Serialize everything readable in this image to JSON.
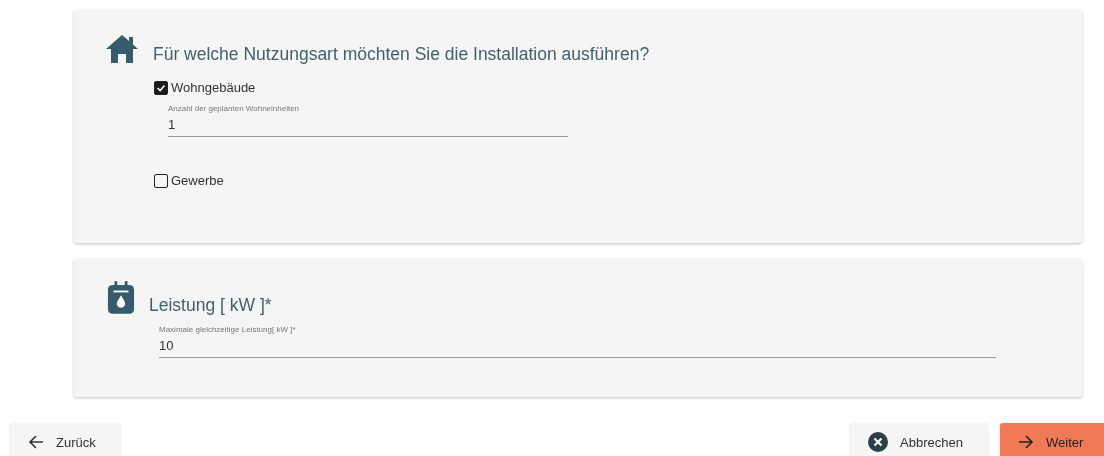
{
  "sections": [
    {
      "kind": "usage",
      "title": "Für welche Nutzungsart möchten Sie die Installation ausführen?",
      "options": [
        {
          "label": "Wohngebäude",
          "checked": true,
          "field": {
            "label": "Anzahl der geplanten Wohneinheiten",
            "value": "1"
          }
        },
        {
          "label": "Gewerbe",
          "checked": false
        }
      ]
    },
    {
      "kind": "power",
      "title": "Leistung [ kW ]*",
      "field": {
        "label": "Maximale gleichzeitige Leistung[ kW ]*",
        "value": "10"
      }
    }
  ],
  "buttons": [
    {
      "label": "Zurück",
      "kind": "back"
    },
    {
      "label": "Abbrechen",
      "kind": "cancel"
    },
    {
      "label": "Weiter",
      "kind": "next"
    }
  ]
}
